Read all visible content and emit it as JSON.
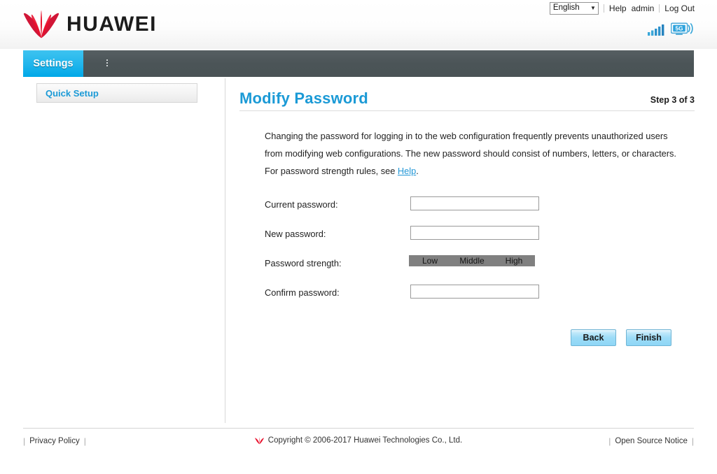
{
  "header": {
    "brand": "HUAWEI",
    "logo_icon": "huawei-flower-logo",
    "language": {
      "selected": "English",
      "caret_icon": "chevron-down-icon",
      "options": [
        "English"
      ]
    },
    "help_label": "Help",
    "user_label": "admin",
    "logout_label": "Log Out",
    "signal_icon": "signal-bars-icon",
    "network_icon": "5g-network-icon",
    "network_label": "5G"
  },
  "navbar": {
    "tabs": [
      {
        "label": "Settings",
        "active": true
      }
    ],
    "handle_icon": "drag-dots-icon"
  },
  "sidebar": {
    "items": [
      {
        "label": "Quick Setup",
        "active": true
      }
    ]
  },
  "main": {
    "title": "Modify Password",
    "step": "Step 3 of 3",
    "description_parts": {
      "before": "Changing the password for logging in to the web configuration frequently prevents unauthorized users from modifying web configurations. The new password should consist of numbers, letters, or characters. For password strength rules, see ",
      "link": "Help",
      "after": "."
    },
    "form": {
      "current_password": {
        "label": "Current password:",
        "value": "",
        "placeholder": ""
      },
      "new_password": {
        "label": "New password:",
        "value": "",
        "placeholder": ""
      },
      "password_strength": {
        "label": "Password strength:",
        "levels": [
          "Low",
          "Middle",
          "High"
        ],
        "bar_color": "#808080"
      },
      "confirm_password": {
        "label": "Confirm password:",
        "value": "",
        "placeholder": ""
      }
    },
    "buttons": {
      "back": "Back",
      "finish": "Finish"
    }
  },
  "footer": {
    "privacy_policy": "Privacy Policy",
    "copyright": "Copyright © 2006-2017 Huawei Technologies Co., Ltd.",
    "copyright_icon": "huawei-mini-logo",
    "open_source_notice": "Open Source Notice",
    "pipe": "|"
  },
  "colors": {
    "accent_blue": "#1b9ad6",
    "tab_blue": "#22b6ec",
    "nav_gray": "#4b5457",
    "brand_red": "#cf0a2c",
    "strength_gray": "#808080"
  }
}
